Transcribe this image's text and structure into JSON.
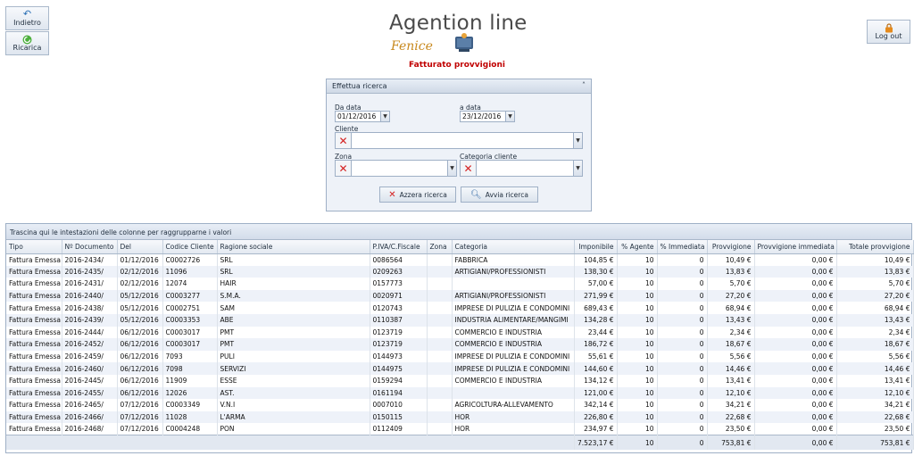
{
  "toolbar": {
    "back_label": "Indietro",
    "reload_label": "Ricarica",
    "logout_label": "Log out"
  },
  "logo": {
    "title": "Agention line",
    "subtitle": "Fenice"
  },
  "page_title": "Fatturato provvigioni",
  "search": {
    "header": "Effettua ricerca",
    "da_data_label": "Da data",
    "da_data_value": "01/12/2016",
    "a_data_label": "a data",
    "a_data_value": "23/12/2016",
    "cliente_label": "Cliente",
    "zona_label": "Zona",
    "categoria_label": "Categoria cliente",
    "reset_label": "Azzera ricerca",
    "search_label": "Avvia ricerca"
  },
  "grid": {
    "group_hint": "Trascina qui le intestazioni delle colonne per raggrupparne i valori",
    "columns": [
      "Tipo",
      "Nº Documento",
      "Del",
      "Codice Cliente",
      "Ragione sociale",
      "P.IVA/C.Fiscale",
      "Zona",
      "Categoria",
      "Imponibile",
      "% Agente",
      "% Immediata",
      "Provvigione",
      "Provvigione immediata",
      "Totale provvigione"
    ],
    "rows": [
      [
        "Fattura Emessa",
        "2016-2434/",
        "01/12/2016",
        "C0002726",
        "                        SRL",
        "0086564",
        "",
        "FABBRICA",
        "104,85 €",
        "10",
        "0",
        "10,49 €",
        "0,00 €",
        "10,49 €"
      ],
      [
        "Fattura Emessa",
        "2016-2435/",
        "02/12/2016",
        "11096",
        "SRL",
        "0209263",
        "",
        "ARTIGIANI/PROFESSIONISTI",
        "138,30 €",
        "10",
        "0",
        "13,83 €",
        "0,00 €",
        "13,83 €"
      ],
      [
        "Fattura Emessa",
        "2016-2431/",
        "02/12/2016",
        "12074",
        "HAIR",
        "0157773",
        "",
        "",
        "57,00 €",
        "10",
        "0",
        "5,70 €",
        "0,00 €",
        "5,70 €"
      ],
      [
        "Fattura Emessa",
        "2016-2440/",
        "05/12/2016",
        "C0003277",
        "S.M.A.",
        "0020971",
        "",
        "ARTIGIANI/PROFESSIONISTI",
        "271,99 €",
        "10",
        "0",
        "27,20 €",
        "0,00 €",
        "27,20 €"
      ],
      [
        "Fattura Emessa",
        "2016-2438/",
        "05/12/2016",
        "C0002751",
        "SAM",
        "0120743",
        "",
        "IMPRESE DI PULIZIA E CONDOMINI",
        "689,43 €",
        "10",
        "0",
        "68,94 €",
        "0,00 €",
        "68,94 €"
      ],
      [
        "Fattura Emessa",
        "2016-2439/",
        "05/12/2016",
        "C0003353",
        "ABE",
        "0110387",
        "",
        "INDUSTRIA ALIMENTARE/MANGIMI",
        "134,28 €",
        "10",
        "0",
        "13,43 €",
        "0,00 €",
        "13,43 €"
      ],
      [
        "Fattura Emessa",
        "2016-2444/",
        "06/12/2016",
        "C0003017",
        "PMT",
        "0123719",
        "",
        "COMMERCIO E INDUSTRIA",
        "23,44 €",
        "10",
        "0",
        "2,34 €",
        "0,00 €",
        "2,34 €"
      ],
      [
        "Fattura Emessa",
        "2016-2452/",
        "06/12/2016",
        "C0003017",
        "PMT",
        "0123719",
        "",
        "COMMERCIO E INDUSTRIA",
        "186,72 €",
        "10",
        "0",
        "18,67 €",
        "0,00 €",
        "18,67 €"
      ],
      [
        "Fattura Emessa",
        "2016-2459/",
        "06/12/2016",
        "7093",
        "PULI",
        "0144973",
        "",
        "IMPRESE DI PULIZIA E CONDOMINI",
        "55,61 €",
        "10",
        "0",
        "5,56 €",
        "0,00 €",
        "5,56 €"
      ],
      [
        "Fattura Emessa",
        "2016-2460/",
        "06/12/2016",
        "7098",
        "SERVIZI",
        "0144975",
        "",
        "IMPRESE DI PULIZIA E CONDOMINI",
        "144,60 €",
        "10",
        "0",
        "14,46 €",
        "0,00 €",
        "14,46 €"
      ],
      [
        "Fattura Emessa",
        "2016-2445/",
        "06/12/2016",
        "11909",
        "ESSE",
        "0159294",
        "",
        "COMMERCIO E INDUSTRIA",
        "134,12 €",
        "10",
        "0",
        "13,41 €",
        "0,00 €",
        "13,41 €"
      ],
      [
        "Fattura Emessa",
        "2016-2455/",
        "06/12/2016",
        "12026",
        "AST.",
        "0161194",
        "",
        "",
        "121,00 €",
        "10",
        "0",
        "12,10 €",
        "0,00 €",
        "12,10 €"
      ],
      [
        "Fattura Emessa",
        "2016-2465/",
        "07/12/2016",
        "C0003349",
        "V.N.I",
        "0007010",
        "",
        "AGRICOLTURA-ALLEVAMENTO",
        "342,14 €",
        "10",
        "0",
        "34,21 €",
        "0,00 €",
        "34,21 €"
      ],
      [
        "Fattura Emessa",
        "2016-2466/",
        "07/12/2016",
        "11028",
        "L'ARMA",
        "0150115",
        "",
        "HOR",
        "226,80 €",
        "10",
        "0",
        "22,68 €",
        "0,00 €",
        "22,68 €"
      ],
      [
        "Fattura Emessa",
        "2016-2468/",
        "07/12/2016",
        "C0004248",
        "PON",
        "0112409",
        "",
        "HOR",
        "234,97 €",
        "10",
        "0",
        "23,50 €",
        "0,00 €",
        "23,50 €"
      ]
    ],
    "totals": {
      "imponibile": "7.523,17 €",
      "agente": "10",
      "immediata": "0",
      "provvigione": "753,81 €",
      "provv_immediata": "0,00 €",
      "totale": "753,81 €"
    }
  }
}
